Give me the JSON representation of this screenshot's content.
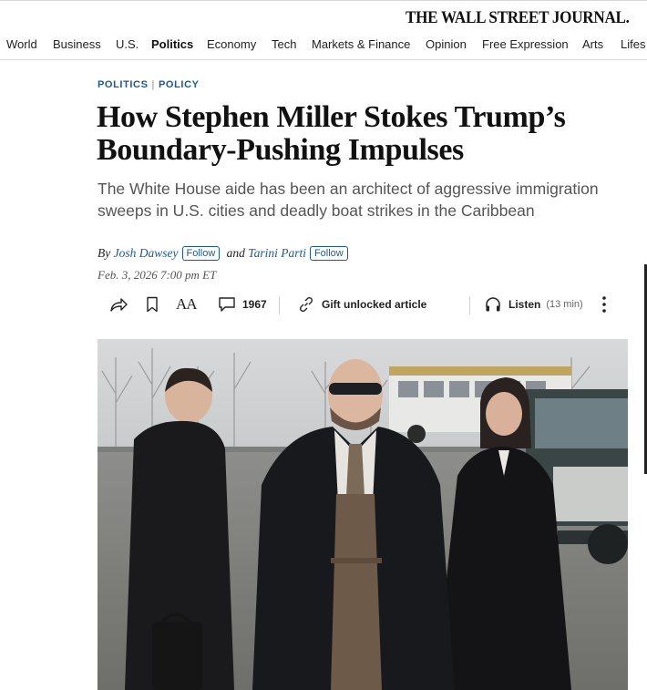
{
  "masthead": {
    "logo": "THE WALL STREET JOURNAL."
  },
  "nav": {
    "items": [
      {
        "label": "World"
      },
      {
        "label": "Business"
      },
      {
        "label": "U.S."
      },
      {
        "label": "Politics"
      },
      {
        "label": "Economy"
      },
      {
        "label": "Tech"
      },
      {
        "label": "Markets & Finance"
      },
      {
        "label": "Opinion"
      },
      {
        "label": "Free Expression"
      },
      {
        "label": "Arts"
      },
      {
        "label": "Lifes"
      }
    ],
    "active": "Politics"
  },
  "article": {
    "kicker": {
      "section": "POLITICS",
      "separator": "|",
      "subsection": "POLICY"
    },
    "headline": "How Stephen Miller Stokes Trump’s Boundary-Pushing Impulses",
    "dek": "The White House aide has been an architect of aggressive immigration sweeps in U.S. cities and deadly boat strikes in the Caribbean",
    "byline": {
      "by": "By",
      "author1": "Josh Dawsey",
      "and": "and",
      "author2": "Tarini Parti",
      "follow_label": "Follow"
    },
    "date": "Feb. 3, 2026 7:00 pm ET"
  },
  "toolbar": {
    "share_icon": "share-icon",
    "bookmark_icon": "bookmark-icon",
    "text_size_label": "AA",
    "comments_count": "1967",
    "gift_label": "Gift unlocked article",
    "listen_label": "Listen",
    "listen_duration": "(13 min)",
    "more_icon": "more-vertical-icon"
  },
  "colors": {
    "link_blue": "#1c5a97",
    "text": "#111111",
    "dek_gray": "#555555"
  }
}
